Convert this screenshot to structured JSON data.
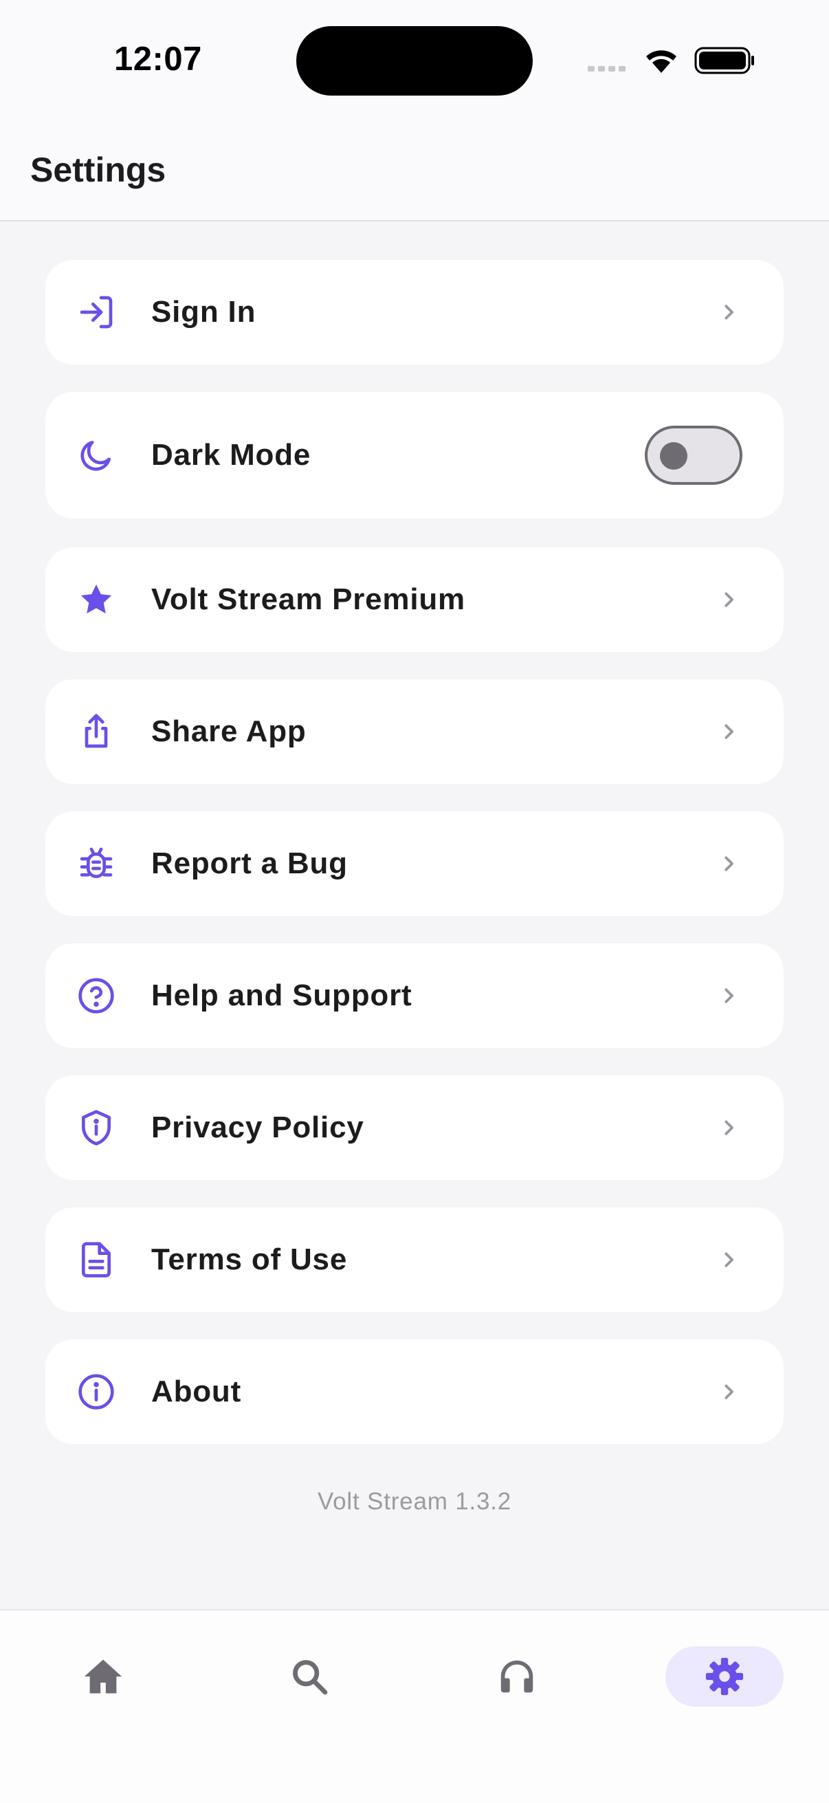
{
  "status_bar": {
    "time": "12:07"
  },
  "header": {
    "title": "Settings"
  },
  "settings": {
    "sign_in": "Sign In",
    "dark_mode": "Dark Mode",
    "dark_mode_enabled": false,
    "premium": "Volt Stream Premium",
    "share": "Share App",
    "report_bug": "Report a Bug",
    "help": "Help and Support",
    "privacy": "Privacy Policy",
    "terms": "Terms of Use",
    "about": "About"
  },
  "footer": {
    "version": "Volt Stream 1.3.2"
  },
  "tabs": [
    {
      "name": "home",
      "icon": "home-icon",
      "active": false
    },
    {
      "name": "search",
      "icon": "search-icon",
      "active": false
    },
    {
      "name": "listen",
      "icon": "headphones-icon",
      "active": false
    },
    {
      "name": "settings",
      "icon": "gear-icon",
      "active": true
    }
  ],
  "colors": {
    "accent": "#6a4fe8",
    "active_tab_bg": "#ece8fd",
    "inactive_icon": "#6e6c72",
    "chevron": "#9a98a0"
  }
}
